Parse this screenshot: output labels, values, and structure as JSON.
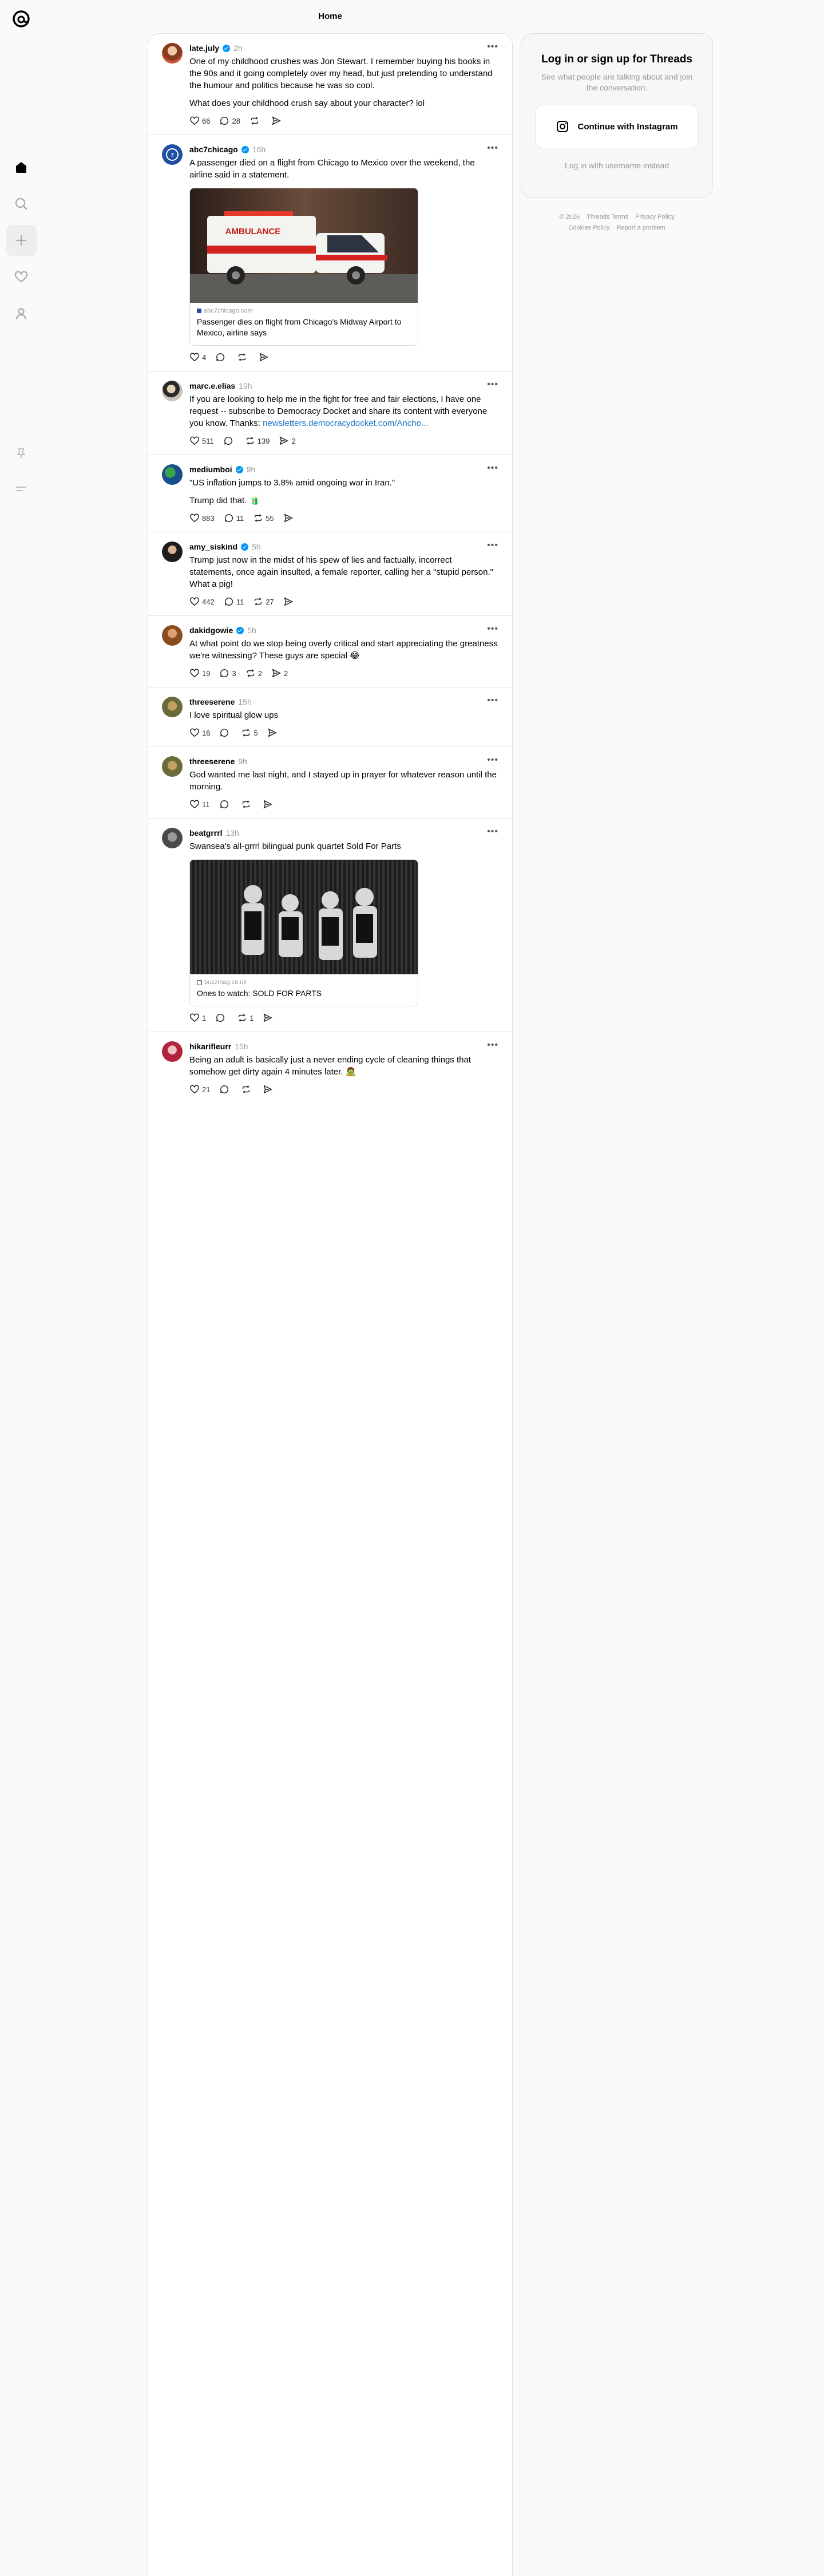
{
  "header": {
    "title": "Home"
  },
  "nav": {
    "items": [
      {
        "icon": "home-icon"
      },
      {
        "icon": "search-icon"
      },
      {
        "icon": "plus-icon"
      },
      {
        "icon": "heart-icon"
      },
      {
        "icon": "profile-icon"
      }
    ],
    "bottom": [
      {
        "icon": "pin-icon"
      },
      {
        "icon": "menu-icon"
      }
    ]
  },
  "posts": [
    {
      "username": "late.july",
      "verified": true,
      "time": "2h",
      "paragraphs": [
        "One of my childhood crushes was Jon Stewart. I remember buying his books in the 90s and it going completely over my head, but just pretending to understand the humour and politics because he was so cool.",
        "What does your childhood crush say about your character? lol"
      ],
      "likes": "66",
      "replies": "28",
      "reposts": "",
      "shares": ""
    },
    {
      "username": "abc7chicago",
      "verified": true,
      "time": "16h",
      "paragraphs": [
        "A passenger died on a flight from Chicago to Mexico over the weekend, the airline said in a statement."
      ],
      "card": {
        "domain": "abc7chicago.com",
        "title": "Passenger dies on flight from Chicago's Midway Airport to Mexico, airline says",
        "img_label": "AMBULANCE"
      },
      "likes": "4",
      "replies": "",
      "reposts": "",
      "shares": ""
    },
    {
      "username": "marc.e.elias",
      "verified": false,
      "time": "19h",
      "text_before_link": "If you are looking to help me in the fight for free and fair elections, I have one request -- subscribe to Democracy Docket and share its content with everyone you know. Thanks: ",
      "link": "newsletters.democracydocket.com/Ancho...",
      "likes": "511",
      "replies": "",
      "reposts": "139",
      "shares": "2"
    },
    {
      "username": "mediumboi",
      "verified": true,
      "time": "9h",
      "paragraphs": [
        "\"US inflation jumps to 3.8% amid ongoing war in Iran.\"",
        "Trump did that. 🧃"
      ],
      "likes": "883",
      "replies": "11",
      "reposts": "55",
      "shares": ""
    },
    {
      "username": "amy_siskind",
      "verified": true,
      "time": "5h",
      "paragraphs": [
        "Trump just now in the midst of his spew of lies and factually, incorrect statements, once again insulted, a female reporter, calling her a \"stupid person.\" What a pig!"
      ],
      "likes": "442",
      "replies": "11",
      "reposts": "27",
      "shares": ""
    },
    {
      "username": "dakidgowie",
      "verified": true,
      "time": "5h",
      "paragraphs": [
        "At what point do we stop being overly critical and start appreciating the greatness we're witnessing? These guys are special 😂"
      ],
      "likes": "19",
      "replies": "3",
      "reposts": "2",
      "shares": "2"
    },
    {
      "username": "threeserene",
      "verified": false,
      "time": "15h",
      "paragraphs": [
        "I love spiritual glow ups"
      ],
      "likes": "16",
      "replies": "",
      "reposts": "5",
      "shares": ""
    },
    {
      "username": "threeserene",
      "verified": false,
      "time": "9h",
      "paragraphs": [
        "God wanted me last night, and I stayed up in prayer for whatever reason until the morning."
      ],
      "likes": "11",
      "replies": "",
      "reposts": "",
      "shares": ""
    },
    {
      "username": "beatgrrrl",
      "verified": false,
      "time": "13h",
      "paragraphs": [
        "Swansea's all-grrrl bilingual punk quartet Sold For Parts"
      ],
      "card": {
        "domain": "buzzmag.co.uk",
        "title": "Ones to watch: SOLD FOR PARTS",
        "img_label": ""
      },
      "likes": "1",
      "replies": "",
      "reposts": "1",
      "shares": ""
    },
    {
      "username": "hikarifleurr",
      "verified": false,
      "time": "15h",
      "paragraphs": [
        "Being an adult is basically just a never ending cycle of cleaning things that somehow get dirty again 4 minutes later. 🧟"
      ],
      "likes": "21",
      "replies": "",
      "reposts": "",
      "shares": ""
    }
  ],
  "login": {
    "title": "Log in or sign up for Threads",
    "subtitle": "See what people are talking about and join the conversation.",
    "button": "Continue with Instagram",
    "alt": "Log in with username instead"
  },
  "footer": {
    "line1": [
      "© 2026",
      "Threads Terms",
      "Privacy Policy"
    ],
    "line2": [
      "Cookies Policy",
      "Report a problem"
    ]
  }
}
